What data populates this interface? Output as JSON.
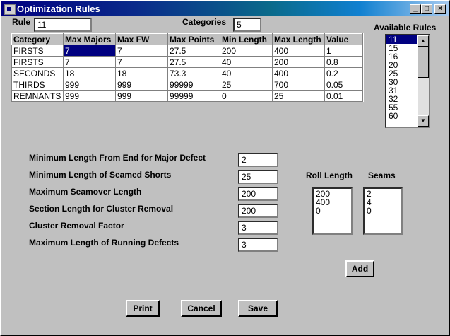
{
  "window": {
    "title": "Optimization Rules"
  },
  "header": {
    "rule_label": "Rule",
    "rule_value": "11",
    "categories_label": "Categories",
    "categories_value": "5"
  },
  "grid": {
    "columns": [
      "Category",
      "Max Majors",
      "Max FW",
      "Max Points",
      "Min Length",
      "Max Length",
      "Value"
    ],
    "rows": [
      [
        "FIRSTS",
        "7",
        "7",
        "27.5",
        "200",
        "400",
        "1"
      ],
      [
        "FIRSTS",
        "7",
        "7",
        "27.5",
        "40",
        "200",
        "0.8"
      ],
      [
        "SECONDS",
        "18",
        "18",
        "73.3",
        "40",
        "400",
        "0.2"
      ],
      [
        "THIRDS",
        "999",
        "999",
        "99999",
        "25",
        "700",
        "0.05"
      ],
      [
        "REMNANTS",
        "999",
        "999",
        "99999",
        "0",
        "25",
        "0.01"
      ]
    ]
  },
  "available_rules": {
    "label": "Available Rules",
    "items": [
      "11",
      "15",
      "16",
      "20",
      "25",
      "30",
      "31",
      "32",
      "55",
      "60"
    ],
    "selected": "11"
  },
  "settings": [
    {
      "label": "Minimum Length From End for Major Defect",
      "value": "2"
    },
    {
      "label": "Minimum Length of Seamed Shorts",
      "value": "25"
    },
    {
      "label": "Maximum Seamover Length",
      "value": "200"
    },
    {
      "label": "Section Length for Cluster Removal",
      "value": "200"
    },
    {
      "label": "Cluster Removal Factor",
      "value": "3"
    },
    {
      "label": "Maximum Length of Running Defects",
      "value": "3"
    }
  ],
  "roll_length": {
    "label": "Roll Length",
    "items": [
      "200",
      "400",
      "0"
    ]
  },
  "seams": {
    "label": "Seams",
    "items": [
      "2",
      "4",
      "0"
    ]
  },
  "buttons": {
    "add": "Add",
    "print": "Print",
    "cancel": "Cancel",
    "save": "Save"
  },
  "colors": {
    "title_start": "#000080",
    "title_end": "#a6caf0",
    "selection": "#000080",
    "face": "#c0c0c0"
  }
}
